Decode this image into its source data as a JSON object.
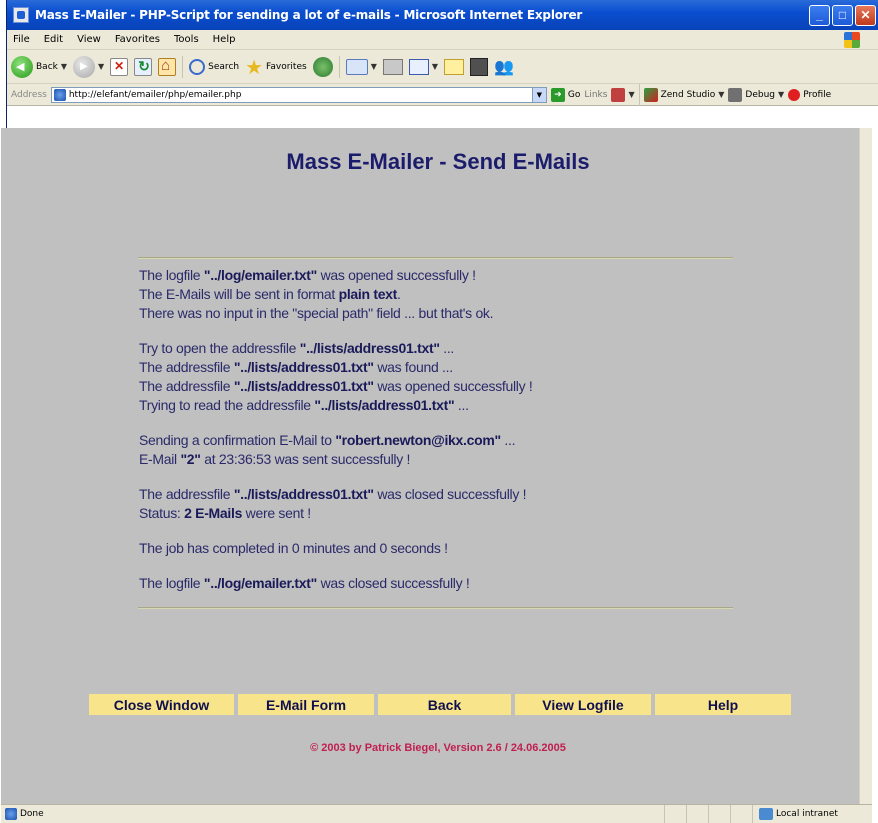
{
  "window": {
    "title": "Mass E-Mailer - PHP-Script for sending a lot of e-mails - Microsoft Internet Explorer",
    "controls": [
      "_",
      "□",
      "✕"
    ]
  },
  "menu": [
    "File",
    "Edit",
    "View",
    "Favorites",
    "Tools",
    "Help"
  ],
  "toolbar": {
    "back_label": "Back",
    "search_label": "Search",
    "favorites_label": "Favorites"
  },
  "address": {
    "label": "Address",
    "url": "http://elefant/emailer/php/emailer.php",
    "go_label": "Go",
    "links_label": "Links",
    "zend_label": "Zend Studio",
    "debug_label": "Debug",
    "profile_label": "Profile"
  },
  "page": {
    "title": "Mass E-Mailer - Send E-Mails",
    "log_groups": [
      [
        [
          {
            "t": "The logfile "
          },
          {
            "b": "\"../log/emailer.txt\""
          },
          {
            "t": " was opened successfully !"
          }
        ],
        [
          {
            "t": "The E-Mails will be sent in format "
          },
          {
            "b": "plain text"
          },
          {
            "t": "."
          }
        ],
        [
          {
            "t": "There was no input in the \"special path\" field ... but that's ok."
          }
        ]
      ],
      [
        [
          {
            "t": "Try to open the addressfile "
          },
          {
            "b": "\"../lists/address01.txt\""
          },
          {
            "t": " ..."
          }
        ],
        [
          {
            "t": "The addressfile "
          },
          {
            "b": "\"../lists/address01.txt\""
          },
          {
            "t": " was found ..."
          }
        ],
        [
          {
            "t": "The addressfile "
          },
          {
            "b": "\"../lists/address01.txt\""
          },
          {
            "t": " was opened successfully !"
          }
        ],
        [
          {
            "t": "Trying to read the addressfile "
          },
          {
            "b": "\"../lists/address01.txt\""
          },
          {
            "t": " ..."
          }
        ]
      ],
      [
        [
          {
            "t": "Sending a confirmation E-Mail to "
          },
          {
            "b": "\"robert.newton@ikx.com\""
          },
          {
            "t": " ..."
          }
        ],
        [
          {
            "t": "E-Mail "
          },
          {
            "b": "\"2\""
          },
          {
            "t": " at 23:36:53 was sent successfully !"
          }
        ]
      ],
      [
        [
          {
            "t": "The addressfile "
          },
          {
            "b": "\"../lists/address01.txt\""
          },
          {
            "t": " was closed successfully !"
          }
        ],
        [
          {
            "t": "Status: "
          },
          {
            "b": "2 E-Mails"
          },
          {
            "t": " were sent !"
          }
        ]
      ],
      [
        [
          {
            "t": "The job has completed in 0 minutes and 0 seconds !"
          }
        ]
      ],
      [
        [
          {
            "t": "The logfile "
          },
          {
            "b": "\"../log/emailer.txt\""
          },
          {
            "t": " was closed successfully !"
          }
        ]
      ]
    ],
    "buttons": [
      {
        "label": "Close Window",
        "name": "close-window-button"
      },
      {
        "label": "E-Mail Form",
        "name": "email-form-button"
      },
      {
        "label": "Back",
        "name": "back-nav-button"
      },
      {
        "label": "View Logfile",
        "name": "view-logfile-button"
      },
      {
        "label": "Help",
        "name": "help-button"
      }
    ],
    "copyright": "© 2003 by Patrick Biegel, Version 2.6 / 24.06.2005"
  },
  "status": {
    "text": "Done",
    "zone": "Local intranet"
  },
  "colors": {
    "page_bg": "#c0c0c0",
    "title": "#1c1c6c",
    "button_bg": "#f8e48a",
    "copyright": "#c02050"
  }
}
